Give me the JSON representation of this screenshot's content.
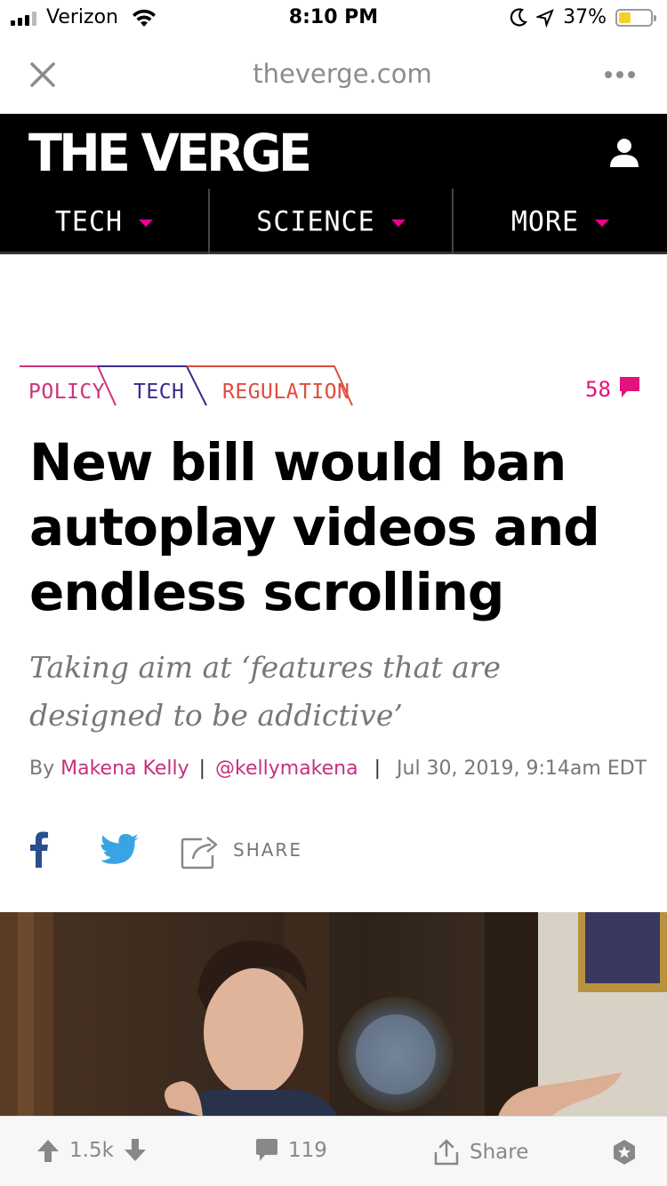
{
  "status_bar": {
    "carrier": "Verizon",
    "time": "8:10 PM",
    "battery_percent": "37%",
    "battery_level": 0.37,
    "battery_color": "#f5cf2b"
  },
  "browser": {
    "url": "theverge.com",
    "close_icon": "close-icon",
    "more_icon": "more-dots-icon"
  },
  "header": {
    "logo": "THE VERGE",
    "nav": [
      {
        "label": "TECH"
      },
      {
        "label": "SCIENCE"
      },
      {
        "label": "MORE"
      }
    ],
    "accent_color": "#ec008c"
  },
  "article": {
    "tags": [
      "POLICY",
      "TECH",
      "REGULATION"
    ],
    "comment_count": "58",
    "headline": "New bill would ban autoplay videos and endless scrolling",
    "dek": "Taking aim at ‘features that are designed to be addictive’",
    "byline": {
      "by": "By",
      "author": "Makena Kelly",
      "handle": "@kellymakena",
      "date": "Jul 30, 2019, 9:14am EDT"
    },
    "share_label": "SHARE"
  },
  "bottom_bar": {
    "upvotes": "1.5k",
    "comments": "119",
    "share": "Share"
  }
}
